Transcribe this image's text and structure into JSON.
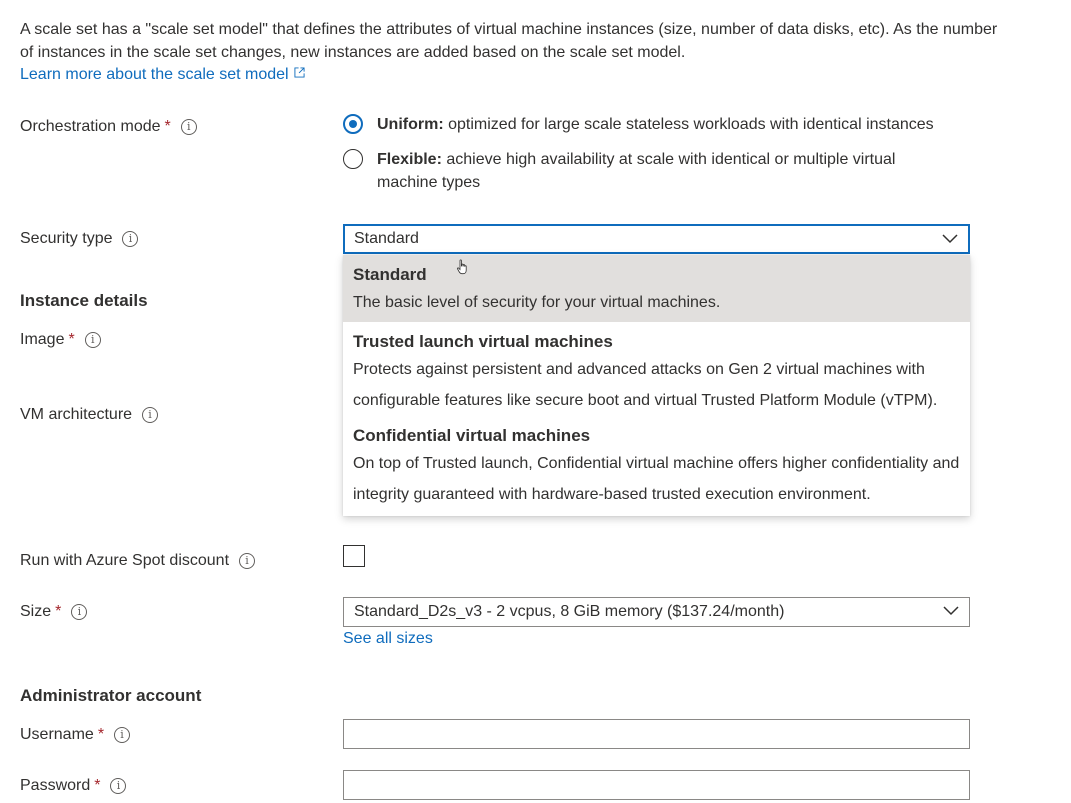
{
  "intro": {
    "text": "A scale set has a \"scale set model\" that defines the attributes of virtual machine instances (size, number of data disks, etc). As the number of instances in the scale set changes, new instances are added based on the scale set model.",
    "link_label": "Learn more about the scale set model"
  },
  "orchestration": {
    "label": "Orchestration mode",
    "options": [
      {
        "title": "Uniform:",
        "desc": "optimized for large scale stateless workloads with identical instances",
        "selected": true
      },
      {
        "title": "Flexible:",
        "desc": "achieve high availability at scale with identical or multiple virtual machine types",
        "selected": false
      }
    ]
  },
  "security": {
    "label": "Security type",
    "value": "Standard",
    "options": [
      {
        "title": "Standard",
        "desc": "The basic level of security for your virtual machines."
      },
      {
        "title": "Trusted launch virtual machines",
        "desc": "Protects against persistent and advanced attacks on Gen 2 virtual machines with configurable features like secure boot and virtual Trusted Platform Module (vTPM)."
      },
      {
        "title": "Confidential virtual machines",
        "desc": "On top of Trusted launch, Confidential virtual machine offers higher confidentiality and integrity guaranteed with hardware-based trusted execution environment."
      }
    ]
  },
  "instance_details": {
    "heading": "Instance details",
    "image_label": "Image",
    "vm_arch_label": "VM architecture",
    "spot_label": "Run with Azure Spot discount",
    "size_label": "Size",
    "size_value": "Standard_D2s_v3 - 2 vcpus, 8 GiB memory ($137.24/month)",
    "see_all_sizes": "See all sizes"
  },
  "admin": {
    "heading": "Administrator account",
    "username_label": "Username",
    "password_label": "Password",
    "username_value": "",
    "password_value": ""
  },
  "required_mark": "*",
  "info_glyph": "i",
  "colors": {
    "accent": "#0f6cbd",
    "required": "#a4262c",
    "hover": "#e1dfdd"
  },
  "icons": [
    "info-icon",
    "external-link-icon",
    "chevron-down-icon",
    "pointer-cursor-icon"
  ]
}
